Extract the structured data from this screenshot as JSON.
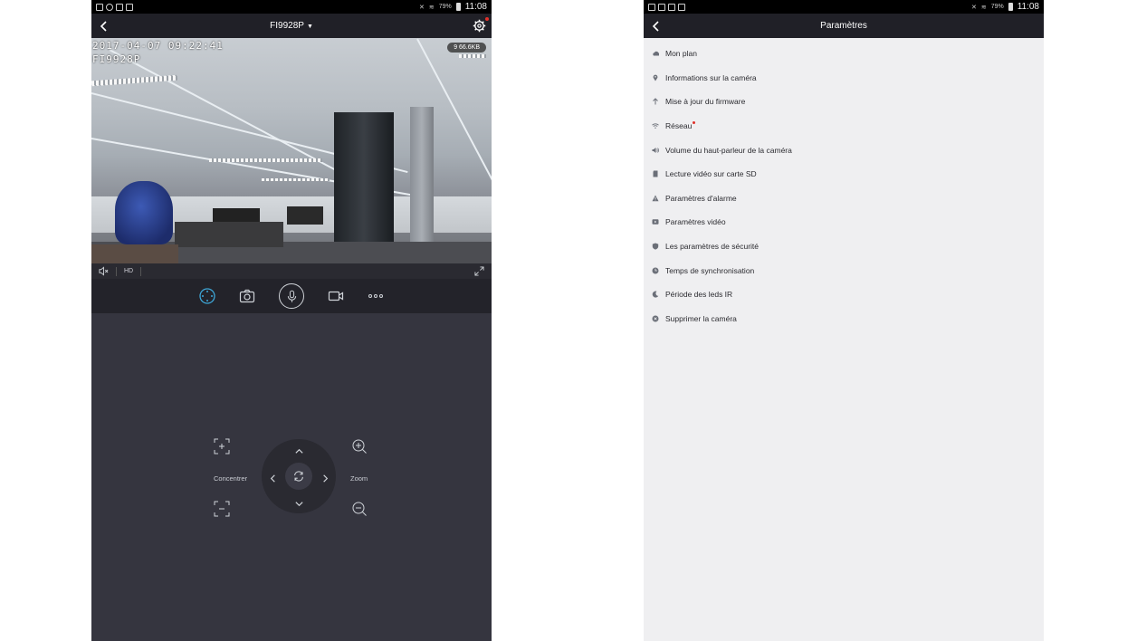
{
  "status_bar": {
    "battery": "79%",
    "time": "11:08"
  },
  "camera_view": {
    "title": "FI9928P",
    "video_timestamp": "2017-04-07 09:22:41",
    "video_camera_name": "FI9928P",
    "bitrate": "9 66.6KB",
    "quality_label": "HD",
    "toolbar_icons": [
      "ptz-icon",
      "snapshot-icon",
      "microphone-icon",
      "record-icon",
      "more-icon"
    ],
    "ptz": {
      "focus_label": "Concentrer",
      "zoom_label": "Zoom"
    }
  },
  "settings": {
    "title": "Paramètres",
    "items": [
      {
        "label": "Mon plan",
        "icon": "cloud-icon"
      },
      {
        "label": "Informations sur la caméra",
        "icon": "location-icon"
      },
      {
        "label": "Mise à jour du firmware",
        "icon": "upload-arrow-icon"
      },
      {
        "label": "Réseau",
        "icon": "wifi-icon",
        "badge": true
      },
      {
        "label": "Volume du haut-parleur de la caméra",
        "icon": "speaker-icon"
      },
      {
        "label": "Lecture vidéo sur carte SD",
        "icon": "sd-card-icon"
      },
      {
        "label": "Paramètres d'alarme",
        "icon": "warning-icon"
      },
      {
        "label": "Paramètres vidéo",
        "icon": "video-icon"
      },
      {
        "label": "Les paramètres de sécurité",
        "icon": "shield-icon"
      },
      {
        "label": "Temps de synchronisation",
        "icon": "clock-icon"
      },
      {
        "label": "Période des leds IR",
        "icon": "moon-icon"
      },
      {
        "label": "Supprimer la caméra",
        "icon": "delete-icon"
      }
    ]
  },
  "colors": {
    "dark_bg": "#35353f",
    "header_bg": "#202027",
    "accent": "#3ea7d8",
    "badge_red": "#e0302a",
    "settings_bg": "#efeff1"
  }
}
